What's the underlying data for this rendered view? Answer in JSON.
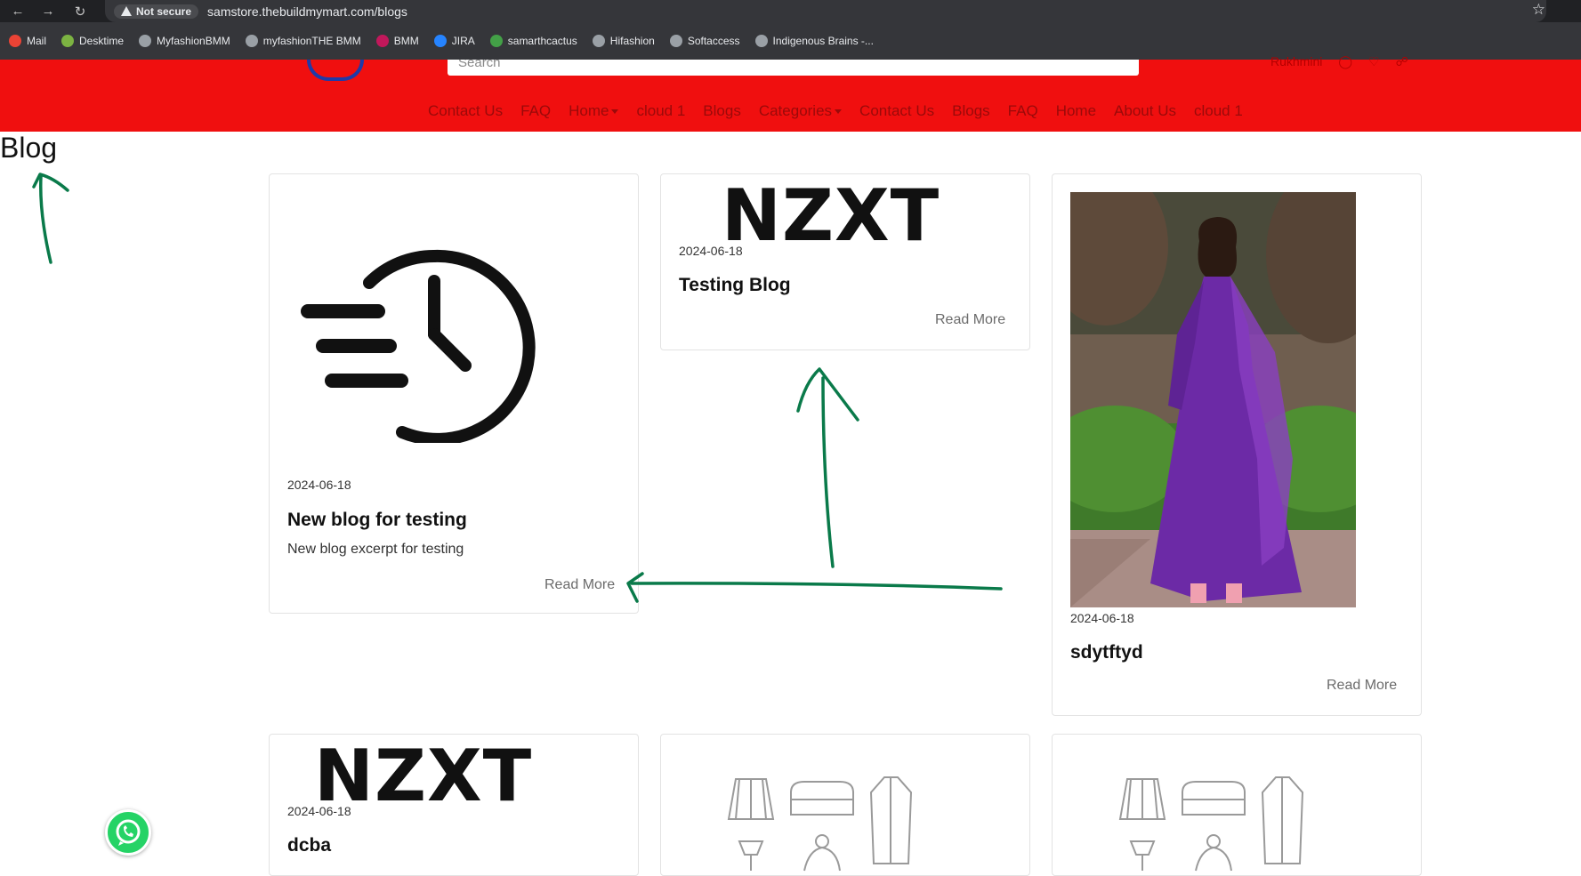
{
  "browser": {
    "security_label": "Not secure",
    "url": "samstore.thebuildmymart.com/blogs",
    "bookmarks": [
      {
        "label": "Mail",
        "color": "#ea4335"
      },
      {
        "label": "Desktime",
        "color": "#7cb342"
      },
      {
        "label": "MyfashionBMM",
        "color": "#9aa0a6"
      },
      {
        "label": "myfashionTHE BMM",
        "color": "#9aa0a6"
      },
      {
        "label": "BMM",
        "color": "#c2185b"
      },
      {
        "label": "JIRA",
        "color": "#2684ff"
      },
      {
        "label": "samarthcactus",
        "color": "#43a047"
      },
      {
        "label": "Hifashion",
        "color": "#9aa0a6"
      },
      {
        "label": "Softaccess",
        "color": "#9aa0a6"
      },
      {
        "label": "Indigenous Brains -...",
        "color": "#9aa0a6"
      }
    ]
  },
  "header": {
    "search_placeholder": "Search",
    "user_name": "Rukhmini",
    "accent_color": "#f00f0f",
    "menu": [
      {
        "label": "Contact Us"
      },
      {
        "label": "FAQ"
      },
      {
        "label": "Home",
        "dropdown": true
      },
      {
        "label": "cloud 1"
      },
      {
        "label": "Blogs"
      },
      {
        "label": "Categories",
        "dropdown": true
      },
      {
        "label": "Contact Us"
      },
      {
        "label": "Blogs"
      },
      {
        "label": "FAQ"
      },
      {
        "label": "Home"
      },
      {
        "label": "About Us"
      },
      {
        "label": "cloud 1"
      }
    ]
  },
  "page": {
    "title": "Blog"
  },
  "blogs": [
    {
      "date": "2024-06-18",
      "title": "New blog for testing",
      "excerpt": "New blog excerpt for testing",
      "read_more": "Read More",
      "image": "fast-clock-icon"
    },
    {
      "date": "2024-06-18",
      "title": "Testing Blog",
      "read_more": "Read More",
      "image": "nzxt-logo",
      "logo_text": "NZXT"
    },
    {
      "date": "2024-06-18",
      "title": "sdytftyd",
      "read_more": "Read More",
      "image": "purple-dress-photo"
    },
    {
      "date": "2024-06-18",
      "title": "dcba",
      "image": "nzxt-logo",
      "logo_text": "NZXT"
    },
    {
      "image": "clothing-icons"
    },
    {
      "image": "clothing-icons"
    }
  ]
}
